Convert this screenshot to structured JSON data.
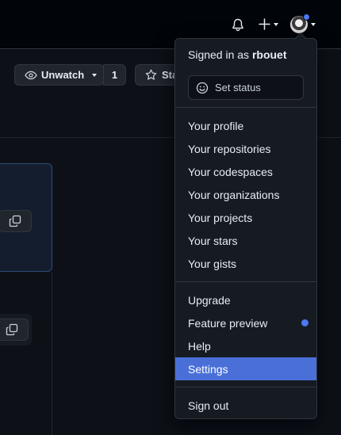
{
  "menu": {
    "signed_in_prefix": "Signed in as",
    "username": "rbouet",
    "set_status": "Set status",
    "groups": [
      [
        "Your profile",
        "Your repositories",
        "Your codespaces",
        "Your organizations",
        "Your projects",
        "Your stars",
        "Your gists"
      ],
      [
        "Upgrade",
        "Feature preview",
        "Help",
        "Settings"
      ],
      [
        "Sign out"
      ]
    ],
    "active_item": "Settings"
  },
  "repo_header": {
    "watch_label": "Unwatch",
    "watch_count": "1",
    "star_label": "Sta"
  },
  "colors": {
    "accent": "#4a70d8",
    "notification_dot": "#4a79f0"
  },
  "icons": {
    "topbar": [
      "bell-icon",
      "plus-icon",
      "avatar"
    ],
    "watch": "eye-icon",
    "star": "star-icon",
    "status": "smiley-icon",
    "copy": "copy-icon"
  }
}
